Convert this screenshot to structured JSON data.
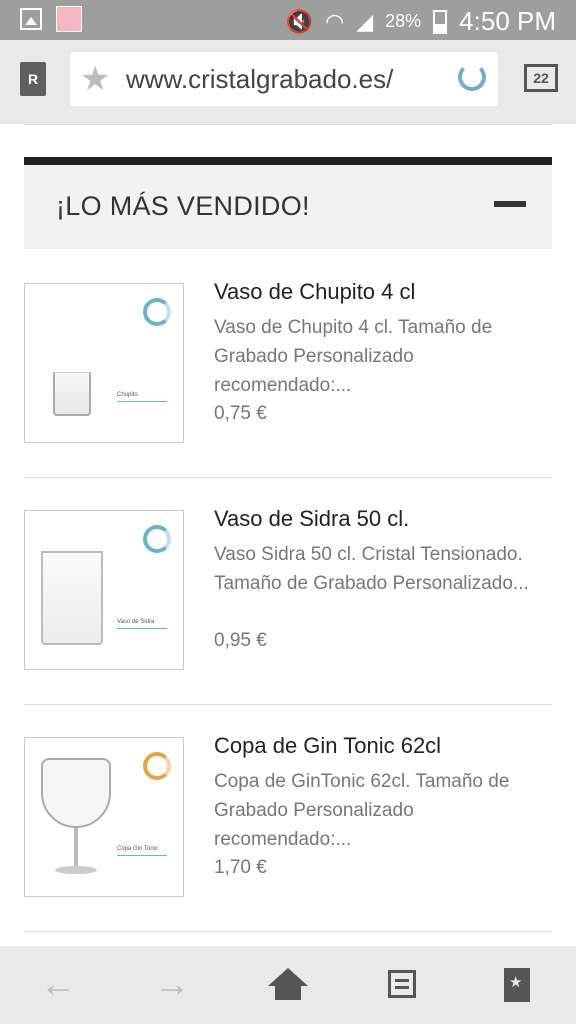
{
  "status_bar": {
    "battery": "28%",
    "time": "4:50 PM"
  },
  "browser": {
    "url": "www.cristalgrabado.es/",
    "tab_count": "22",
    "reader_label": "R"
  },
  "section": {
    "title": "¡LO MÁS VENDIDO!"
  },
  "products": [
    {
      "name": "Vaso de Chupito 4 cl",
      "description": "Vaso de Chupito 4 cl. Tamaño de Grabado Personalizado recomendado:...",
      "price": "0,75 €",
      "thumb_label": "Chupito"
    },
    {
      "name": "Vaso de Sidra 50 cl.",
      "description": "Vaso Sidra 50 cl. Cristal Tensionado. Tamaño de Grabado Personalizado...",
      "price": "0,95 €",
      "thumb_label": "Vaso de Sidra"
    },
    {
      "name": "Copa de Gin Tonic 62cl",
      "description": "Copa de GinTonic 62cl. Tamaño de Grabado Personalizado recomendado:...",
      "price": "1,70 €",
      "thumb_label": "Copa Gin Tonic"
    }
  ],
  "colors": {
    "accent_ring": "#6bb3c7",
    "orange_ring": "#e3a542",
    "header_bar": "#222222"
  },
  "icons": [
    "gallery-icon",
    "avatar-icon",
    "mute-icon",
    "wifi-icon",
    "signal-icon",
    "battery-icon",
    "star-icon",
    "reload-icon",
    "tabs-icon",
    "back-icon",
    "forward-icon",
    "home-icon",
    "reading-list-icon",
    "bookmarks-icon"
  ]
}
